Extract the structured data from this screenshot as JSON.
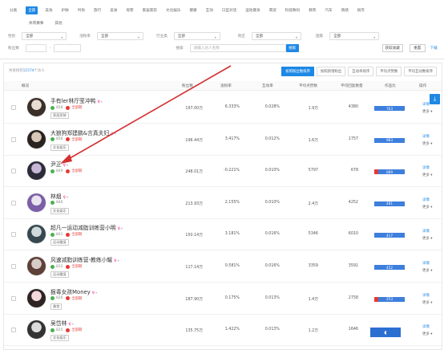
{
  "categories_row1": [
    "分类",
    "全部",
    "美妆",
    "护肤",
    "时尚",
    "旅行",
    "美食",
    "母婴",
    "家居家装",
    "文化娱乐",
    "健康",
    "互动",
    "口型对话",
    "运动健身",
    "萌宠",
    "科技数码",
    "教育",
    "汽车",
    "情感",
    "搞笑"
  ],
  "categories_row2": [
    "体育赛事",
    "其他"
  ],
  "filters": {
    "row1": [
      {
        "label": "性别",
        "value": "全部"
      },
      {
        "label": "涨粉率",
        "value": "全部"
      },
      {
        "label": "行业类",
        "value": "全部"
      },
      {
        "label": "地区",
        "value": "全部"
      },
      {
        "label": "国家",
        "value": "全部"
      }
    ],
    "row2": {
      "fans_label": "粉丝数",
      "range_sep": "-",
      "search_label": "搜索",
      "search_placeholder": "请输入达人名称",
      "search_button": "搜索",
      "fav_button": "获取收藏",
      "reset_button": "重置",
      "download_link": "下载"
    }
  },
  "results": {
    "prefix": "共查找到",
    "count": "11574",
    "suffix": "个达人"
  },
  "tabs": [
    {
      "label": "按照粉丝数排序",
      "active": true
    },
    {
      "label": "按照新增粉丝",
      "active": false
    },
    {
      "label": "互动率排序",
      "active": false
    },
    {
      "label": "平均点赞数",
      "active": false
    },
    {
      "label": "平均互动数排序",
      "active": false
    }
  ],
  "headers": [
    "概况",
    "粉丝数",
    "涨粉率",
    "互动率",
    "平均点赞数",
    "平均回复数量",
    "作品比",
    "操作"
  ],
  "rows": [
    {
      "name": "手有ler林厅莹冲鸭",
      "fans_small": "858",
      "badge": "全部期",
      "tag": "家居家装",
      "fans": "197.00万",
      "growth": "6.333%",
      "engage": "0.028%",
      "likes": "1.9万",
      "replies": "4380",
      "bar": "703",
      "red": false
    },
    {
      "name": "大狼狗郑建鹏&言真夫妇",
      "fans_small": "856",
      "badge": "全部期",
      "tag": "文化娱乐",
      "fans": "196.44万",
      "growth": "3.417%",
      "engage": "0.012%",
      "likes": "1.6万",
      "replies": "1757",
      "bar": "983",
      "red": false
    },
    {
      "name": "尹正",
      "fans_small": "849",
      "badge": "全部期",
      "tag": "",
      "fans": "248.01万",
      "growth": "-0.221%",
      "engage": "0.010%",
      "likes": "5797",
      "replies": "678",
      "bar": "689",
      "red": true
    },
    {
      "name": "林烟",
      "fans_small": "846",
      "badge": "",
      "tag": "文化娱乐",
      "fans": "213.93万",
      "growth": "2.155%",
      "engage": "0.010%",
      "likes": "2.4万",
      "replies": "4252",
      "bar": "481",
      "red": false
    },
    {
      "name": "超凡一运动减脂训练营小明",
      "fans_small": "841",
      "badge": "全部期",
      "tag": "运动健身",
      "fans": "150.14万",
      "growth": "3.181%",
      "engage": "0.016%",
      "likes": "5346",
      "replies": "6010",
      "bar": "417",
      "red": false
    },
    {
      "name": "风速减脂训练营-教练小耀",
      "fans_small": "833",
      "badge": "全部期",
      "tag": "运动健身",
      "fans": "117.14万",
      "growth": "0.581%",
      "engage": "0.016%",
      "likes": "3359",
      "replies": "3591",
      "bar": "452",
      "red": false
    },
    {
      "name": "狠毒女孩Money",
      "fans_small": "826",
      "badge": "全部期",
      "tag": "美妆",
      "fans": "187.90万",
      "growth": "0.175%",
      "engage": "0.013%",
      "likes": "1.4万",
      "replies": "2758",
      "bar": "253",
      "red": true
    },
    {
      "name": "吴岱林",
      "fans_small": "825",
      "badge": "全部期",
      "tag": "文化娱乐",
      "fans": "135.75万",
      "growth": "1.422%",
      "engage": "0.013%",
      "likes": "1.2万",
      "replies": "1646",
      "bar": "",
      "red": false
    }
  ],
  "ops": {
    "detail": "详情",
    "more": "更多"
  },
  "icons": [
    "download-icon",
    "location-icon",
    "gender-icon"
  ]
}
